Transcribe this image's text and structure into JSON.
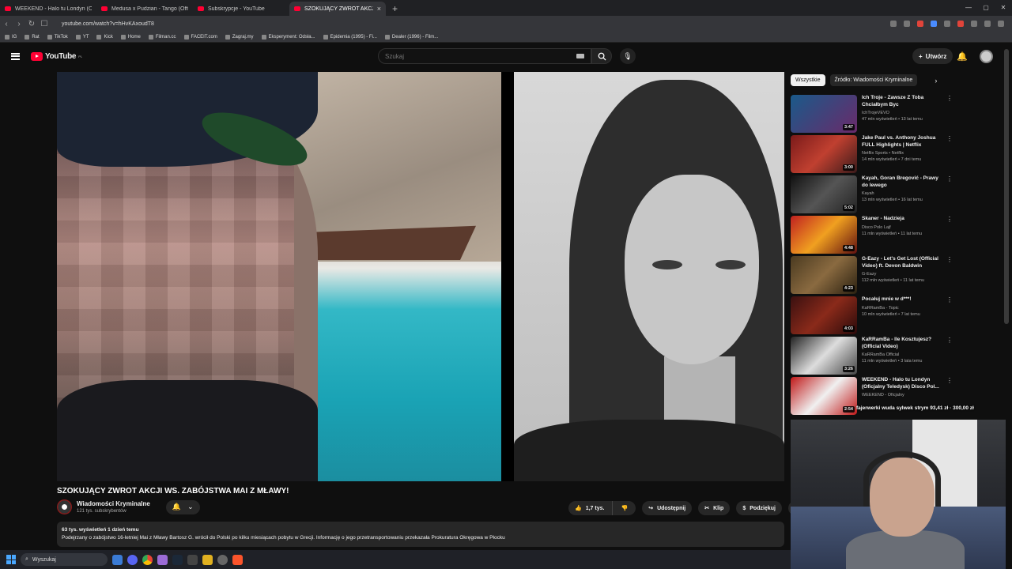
{
  "browser": {
    "tabs": [
      {
        "title": "WEEKEND - Halo tu Londyn (Oficjaln",
        "active": false
      },
      {
        "title": "Medusa x Pudzian - Tango (Official V",
        "active": false
      },
      {
        "title": "Subskrypcje - YouTube",
        "active": false
      },
      {
        "title": "SZOKUJĄCY ZWROT AKCJI W",
        "active": true
      }
    ],
    "url": "youtube.com/watch?v=hHvKAxoudT8",
    "bookmarks": [
      "IG",
      "Rat",
      "TikTok",
      "YT",
      "Kick",
      "Home",
      "Filman.cc",
      "FACEIT.com",
      "Zagraj.my",
      "Eksperyment: Odsła...",
      "Epidemia (1995) - Fi...",
      "Dealer (1996) - Film..."
    ]
  },
  "header": {
    "logo": "YouTube",
    "region": "PL",
    "search_placeholder": "Szukaj",
    "create_label": "Utwórz"
  },
  "video": {
    "title": "SZOKUJĄCY ZWROT AKCJI WS. ZABÓJSTWA MAI Z MŁAWY!",
    "channel": "Wiadomości Kryminalne",
    "subscribers": "121 tys. subskrybentów",
    "likes": "1,7 tys.",
    "share_label": "Udostępnij",
    "clip_label": "Klip",
    "thanks_label": "Podziękuj",
    "stats": "63 tys. wyświetleń  1 dzień temu",
    "description": "Podejrzany o zabójstwo 16-letniej Mai z Mławy Bartosz G. wrócił do Polski po kilku miesiącach pobytu w Grecji. Informację o jego przetransportowaniu przekazała Prokuratura Okręgowa w Płocku"
  },
  "sidebar": {
    "chips": [
      "Wszystkie",
      "Źródło: Wiadomości Kryminalne"
    ],
    "recommendations": [
      {
        "title": "Ich Troje - Zawsze Z Toba Chciałbym Byc",
        "channel": "IchTrojeVEVO",
        "meta": "47 mln wyświetleń • 13 lat temu",
        "duration": "3:47"
      },
      {
        "title": "Jake Paul vs. Anthony Joshua FULL Highlights | Netflix",
        "channel": "Netflix Sports • Netflix",
        "meta": "14 mln wyświetleń • 7 dni temu",
        "duration": "3:00"
      },
      {
        "title": "Kayah, Goran Bregović - Prawy do lewego",
        "channel": "Kayah",
        "meta": "13 mln wyświetleń • 16 lat temu",
        "duration": "5:02"
      },
      {
        "title": "Skaner - Nadzieja",
        "channel": "Disco Polo Lajf",
        "meta": "11 mln wyświetleń • 11 lat temu",
        "duration": "4:48"
      },
      {
        "title": "G-Eazy - Let's Get Lost (Official Video) ft. Devon Baldwin",
        "channel": "G-Eazy",
        "meta": "112 mln wyświetleń • 11 lat temu",
        "duration": "4:23"
      },
      {
        "title": "Pocałuj mnie w d***!",
        "channel": "KaRRamBa - Topic",
        "meta": "10 mln wyświetleń • 7 lat temu",
        "duration": "4:03"
      },
      {
        "title": "KaRRamBa - Ile Kosztujesz? (Official Video)",
        "channel": "KaRRamBa Official",
        "meta": "11 mln wyświetleń • 3 lata temu",
        "duration": "3:26"
      },
      {
        "title": "WEEKEND - Halo tu Londyn (Oficjalny Teledysk) Disco Pol...",
        "channel": "WEEKEND - Oficjalny",
        "meta": "",
        "duration": "2:54"
      }
    ]
  },
  "overlay": {
    "donation": "fajerwerki wuda sylwek strym  93,41 zł  ·  300,00 zł"
  },
  "taskbar": {
    "search_label": "Wyszukaj"
  }
}
